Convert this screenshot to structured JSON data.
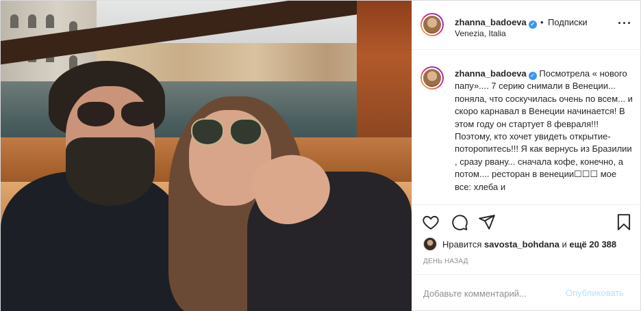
{
  "post": {
    "username": "zhanna_badoeva",
    "separator": "•",
    "follow_label": "Подписки",
    "location": "Venezia, Italia",
    "more_icon": "more-horizontal-icon",
    "caption_text": "Посмотрела « нового папу».... 7 серию снимали в Венеции... поняла, что соскучилась очень по всем... и скоро карнавал в Венеции начинается! В этом году он стартует 8 февраля!!! Поэтому, кто хочет увидеть открытие- поторопитесь!!! Я как вернусь из Бразилии , сразу рвану... сначала кофе, конечно, а потом.... ресторан в венеции☐☐☐ мое все: хлеба и",
    "actions": {
      "like_icon": "heart-icon",
      "comment_icon": "comment-icon",
      "share_icon": "paper-plane-icon",
      "save_icon": "bookmark-icon"
    },
    "likes": {
      "prefix": "Нравится",
      "user": "savosta_bohdana",
      "middle": "и",
      "rest": "ещё 20 388"
    },
    "time_label": "День назад",
    "comment_placeholder": "Добавьте комментарий...",
    "publish_label": "Опубликовать"
  }
}
